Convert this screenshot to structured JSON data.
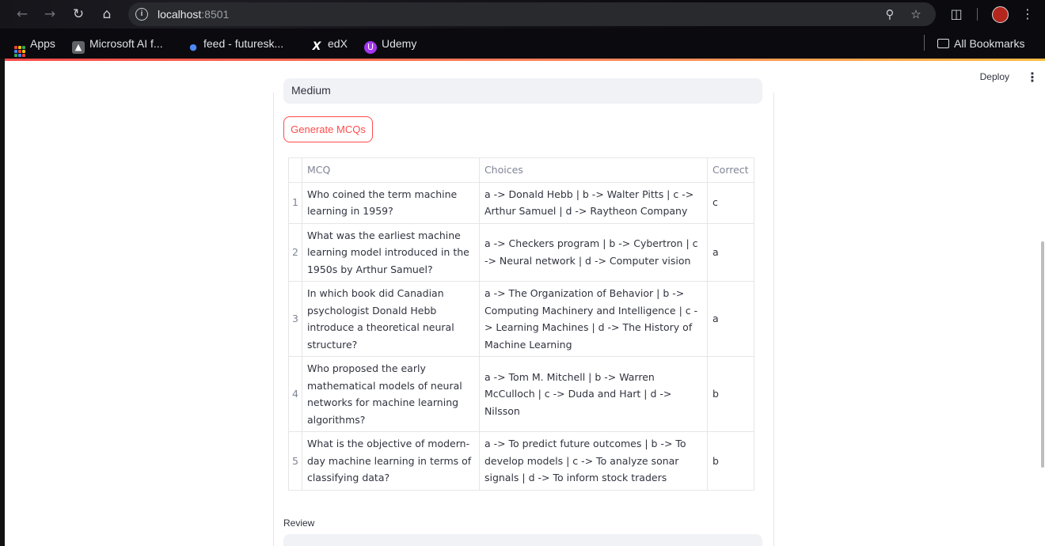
{
  "browser": {
    "url_host": "localhost",
    "url_port": ":8501",
    "icons": {
      "back": "arrow-left-icon",
      "forward": "arrow-right-icon",
      "reload": "reload-icon",
      "home": "home-icon",
      "zoom": "zoom-icon",
      "star": "star-icon",
      "extensions": "puzzle-icon",
      "menu": "kebab-icon"
    },
    "bookmarks": [
      {
        "label": "Apps"
      },
      {
        "label": "Microsoft AI f..."
      },
      {
        "label": "feed - futuresk..."
      },
      {
        "label": "edX"
      },
      {
        "label": "Udemy"
      }
    ],
    "all_bookmarks": "All Bookmarks"
  },
  "app": {
    "deploy_label": "Deploy",
    "select_value": "Medium",
    "generate_button": "Generate MCQs",
    "review_label": "Review",
    "accent_color": "#ff4b4b"
  },
  "table": {
    "headers": [
      "MCQ",
      "Choices",
      "Correct"
    ],
    "rows": [
      {
        "index": "1",
        "mcq": "Who coined the term machine learning in 1959?",
        "choices": "a -> Donald Hebb | b -> Walter Pitts | c -> Arthur Samuel | d -> Raytheon Company",
        "correct": "c"
      },
      {
        "index": "2",
        "mcq": "What was the earliest machine learning model introduced in the 1950s by Arthur Samuel?",
        "choices": "a -> Checkers program | b -> Cybertron | c -> Neural network | d -> Computer vision",
        "correct": "a"
      },
      {
        "index": "3",
        "mcq": "In which book did Canadian psychologist Donald Hebb introduce a theoretical neural structure?",
        "choices": "a -> The Organization of Behavior | b -> Computing Machinery and Intelligence | c -> Learning Machines | d -> The History of Machine Learning",
        "correct": "a"
      },
      {
        "index": "4",
        "mcq": "Who proposed the early mathematical models of neural networks for machine learning algorithms?",
        "choices": "a -> Tom M. Mitchell | b -> Warren McCulloch | c -> Duda and Hart | d -> Nilsson",
        "correct": "b"
      },
      {
        "index": "5",
        "mcq": "What is the objective of modern-day machine learning in terms of classifying data?",
        "choices": "a -> To predict future outcomes | b -> To develop models | c -> To analyze sonar signals | d -> To inform stock traders",
        "correct": "b"
      }
    ]
  }
}
